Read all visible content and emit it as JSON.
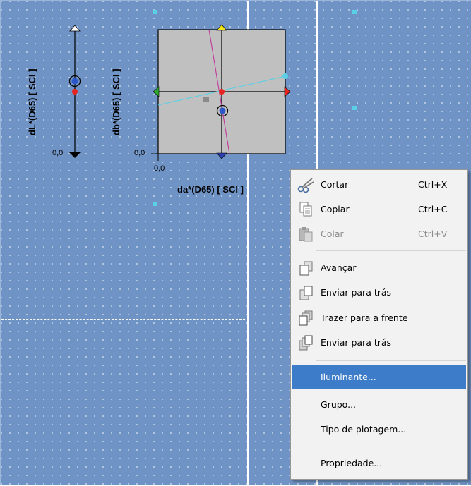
{
  "left_chart": {
    "y_axis_label": "dL*(D65) [ SCI ]",
    "tick_zero": "0,0"
  },
  "main_chart": {
    "y_axis_label": "db*(D65) [ SCI ]",
    "x_axis_label": "da*(D65) [ SCI ]",
    "y_tick_zero": "0,0",
    "x_tick_zero": "0,0"
  },
  "colors": {
    "canvas": "#6f93c4",
    "selection": "#3d7cc8",
    "standard_point": "#e8231f",
    "sample_point": "#2b57c9",
    "plot_bg": "#c0c0c0"
  },
  "context_menu": {
    "items": [
      {
        "label": "Cortar",
        "shortcut": "Ctrl+X",
        "icon": "scissors-icon",
        "enabled": true
      },
      {
        "label": "Copiar",
        "shortcut": "Ctrl+C",
        "icon": "copy-icon",
        "enabled": true
      },
      {
        "label": "Colar",
        "shortcut": "Ctrl+V",
        "icon": "paste-icon",
        "enabled": false
      },
      {
        "label": "Avançar",
        "shortcut": "",
        "icon": "bring-forward-icon",
        "enabled": true
      },
      {
        "label": "Enviar para trás",
        "shortcut": "",
        "icon": "send-backward-icon",
        "enabled": true
      },
      {
        "label": "Trazer para a frente",
        "shortcut": "",
        "icon": "bring-to-front-icon",
        "enabled": true
      },
      {
        "label": "Enviar para trás",
        "shortcut": "",
        "icon": "send-to-back-icon",
        "enabled": true
      },
      {
        "label": "Iluminante...",
        "shortcut": "",
        "icon": "",
        "enabled": true,
        "selected": true
      },
      {
        "label": "Grupo...",
        "shortcut": "",
        "icon": "",
        "enabled": true
      },
      {
        "label": "Tipo de plotagem...",
        "shortcut": "",
        "icon": "",
        "enabled": true
      },
      {
        "label": "Propriedade...",
        "shortcut": "",
        "icon": "",
        "enabled": true
      }
    ]
  }
}
